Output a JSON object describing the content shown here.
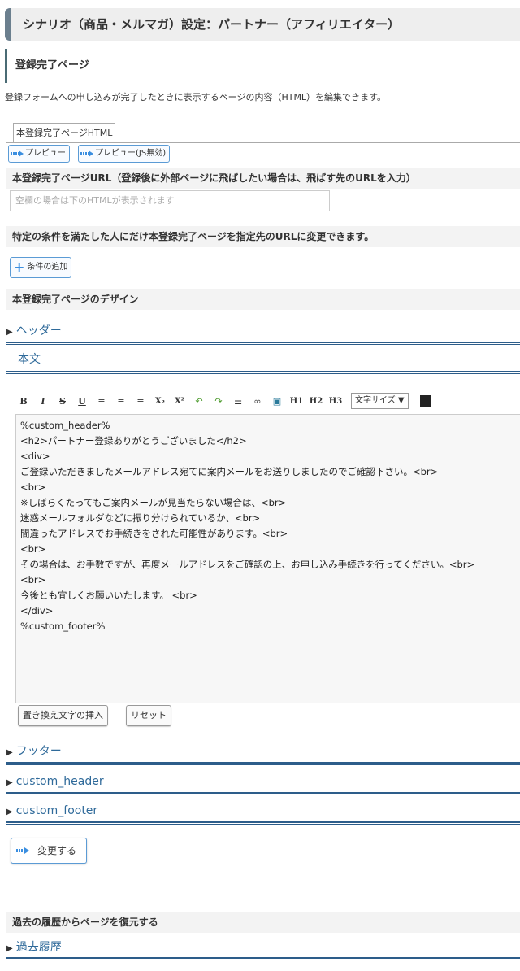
{
  "page_title": "シナリオ（商品・メルマガ）設定：パートナー（アフィリエイター）",
  "section_title": "登録完了ページ",
  "description": "登録フォームへの申し込みが完了したときに表示するページの内容（HTML）を編集できます。",
  "tab_label": "本登録完了ページHTML",
  "preview_button": "プレビュー",
  "preview_nojs_button": "プレビュー(JS無効)",
  "url_label": "本登録完了ページURL（登録後に外部ページに飛ばしたい場合は、飛ばす先のURLを入力）",
  "url_placeholder": "空欄の場合は下のHTMLが表示されます",
  "condition_label": "特定の条件を満たした人にだけ本登録完了ページを指定先のURLに変更できます。",
  "add_condition_button": "条件の追加",
  "design_label": "本登録完了ページのデザイン",
  "accordions": {
    "header": "ヘッダー",
    "body": "本文",
    "footer": "フッター",
    "custom_header": "custom_header",
    "custom_footer": "custom_footer",
    "history": "過去履歴"
  },
  "toolbar": {
    "bold": "B",
    "italic": "I",
    "strike": "S",
    "underline": "U",
    "sub": "X₂",
    "sup": "X²",
    "h1": "H1",
    "h2": "H2",
    "h3": "H3",
    "font_size": "文字サイズ ▼"
  },
  "editor_lines": [
    "%custom_header%",
    "<h2>パートナー登録ありがとうございました</h2>",
    "<div>",
    "ご登録いただきましたメールアドレス宛てに案内メールをお送りしましたのでご確認下さい。<br>",
    "<br>",
    "※しばらくたってもご案内メールが見当たらない場合は、<br>",
    "迷惑メールフォルダなどに振り分けられているか、<br>",
    "間違ったアドレスでお手続きをされた可能性があります。<br>",
    "<br>",
    "その場合は、お手数ですが、再度メールアドレスをご確認の上、お申し込み手続きを行ってください。<br>",
    "<br>",
    "今後とも宜しくお願いいたします。 <br>",
    "</div>",
    "%custom_footer%"
  ],
  "insert_button": "置き換え文字の挿入",
  "reset_button": "リセット",
  "submit_button": "変更する",
  "restore_label": "過去の履歴からページを復元する"
}
